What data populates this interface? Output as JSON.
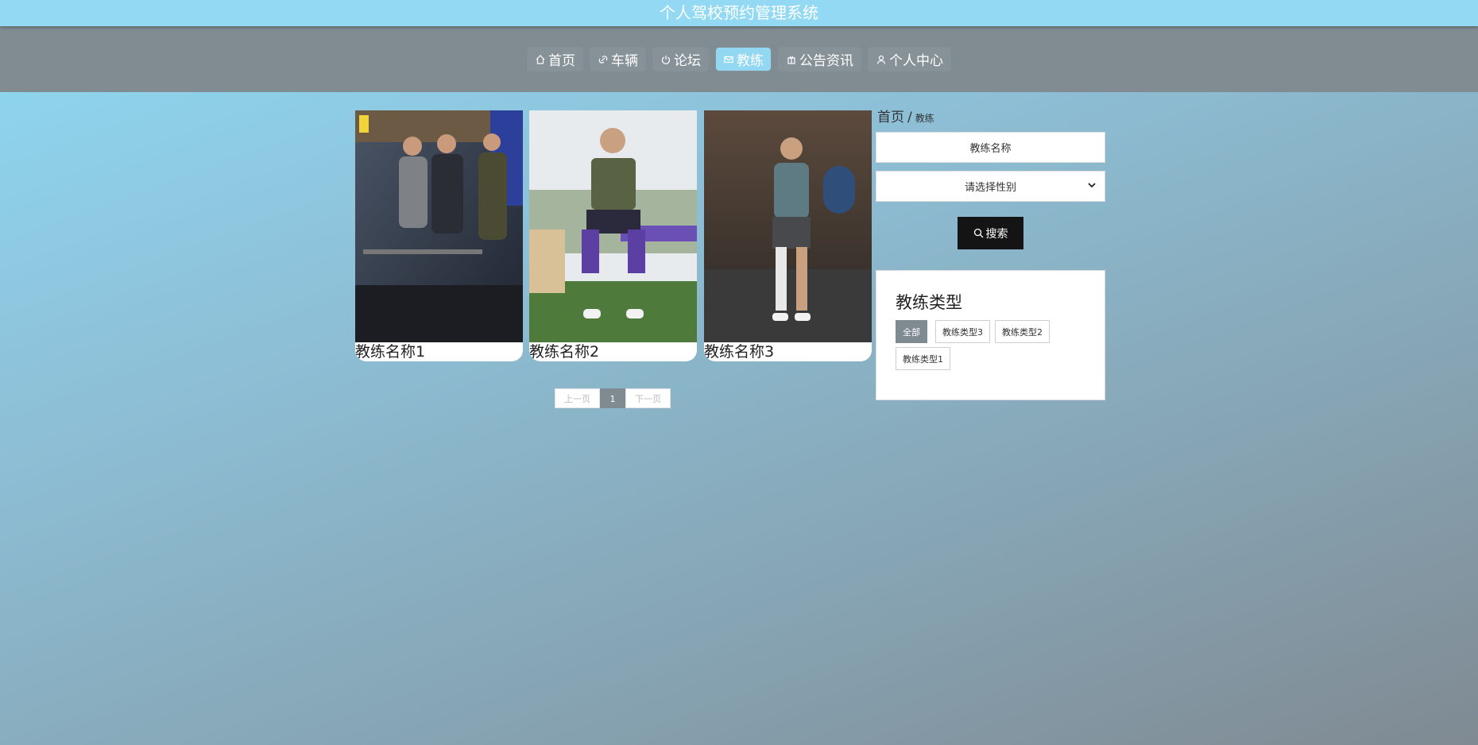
{
  "header": {
    "title": "个人驾校预约管理系统"
  },
  "nav": {
    "items": [
      {
        "label": "首页",
        "icon": "home-icon"
      },
      {
        "label": "车辆",
        "icon": "link-icon"
      },
      {
        "label": "论坛",
        "icon": "power-icon"
      },
      {
        "label": "教练",
        "icon": "mail-icon",
        "active": true
      },
      {
        "label": "公告资讯",
        "icon": "gift-icon"
      },
      {
        "label": "个人中心",
        "icon": "user-icon"
      }
    ]
  },
  "coaches": [
    {
      "name": "教练名称1"
    },
    {
      "name": "教练名称2"
    },
    {
      "name": "教练名称3"
    }
  ],
  "pagination": {
    "prev": "上一页",
    "current": "1",
    "next": "下一页"
  },
  "breadcrumb": {
    "home": "首页",
    "separator": "/",
    "current": "教练"
  },
  "search": {
    "name_placeholder": "教练名称",
    "gender_placeholder": "请选择性别",
    "button": "搜索"
  },
  "types": {
    "title": "教练类型",
    "items": [
      "全部",
      "教练类型3",
      "教练类型2",
      "教练类型1"
    ],
    "active": "全部"
  },
  "colors": {
    "topbar": "#93d9f3",
    "navband": "#808c92",
    "active_nav": "#92d8f2",
    "search_button": "#141414",
    "active_tag": "#808a91"
  }
}
